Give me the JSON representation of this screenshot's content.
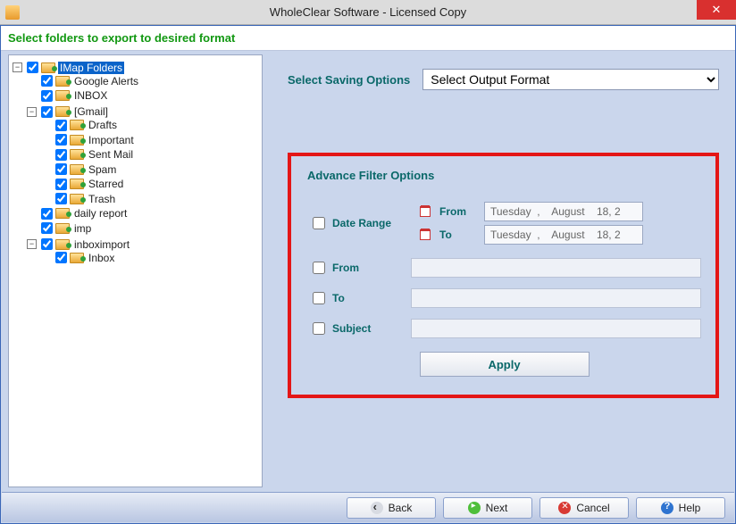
{
  "window": {
    "title": "WholeClear Software - Licensed Copy"
  },
  "instruction": "Select folders to export to desired format",
  "tree": {
    "root": {
      "label": "IMap Folders",
      "selected": true,
      "items": [
        {
          "label": "Google Alerts"
        },
        {
          "label": "INBOX"
        },
        {
          "label": "[Gmail]",
          "children": [
            {
              "label": "Drafts"
            },
            {
              "label": "Important"
            },
            {
              "label": "Sent Mail"
            },
            {
              "label": "Spam"
            },
            {
              "label": "Starred"
            },
            {
              "label": "Trash"
            }
          ]
        },
        {
          "label": "daily report"
        },
        {
          "label": "imp"
        },
        {
          "label": "inboximport",
          "children": [
            {
              "label": "Inbox"
            }
          ]
        }
      ]
    }
  },
  "saving": {
    "label": "Select Saving Options",
    "selected": "Select Output Format"
  },
  "filter": {
    "title": "Advance Filter Options",
    "date_range_label": "Date Range",
    "from_label": "From",
    "to_label": "To",
    "subject_label": "Subject",
    "date_from_label": "From",
    "date_to_label": "To",
    "date_from_value": "Tuesday  ,    August    18, 2",
    "date_to_value": "Tuesday  ,    August    18, 2",
    "apply_label": "Apply"
  },
  "footer": {
    "back": "Back",
    "next": "Next",
    "cancel": "Cancel",
    "help": "Help"
  }
}
